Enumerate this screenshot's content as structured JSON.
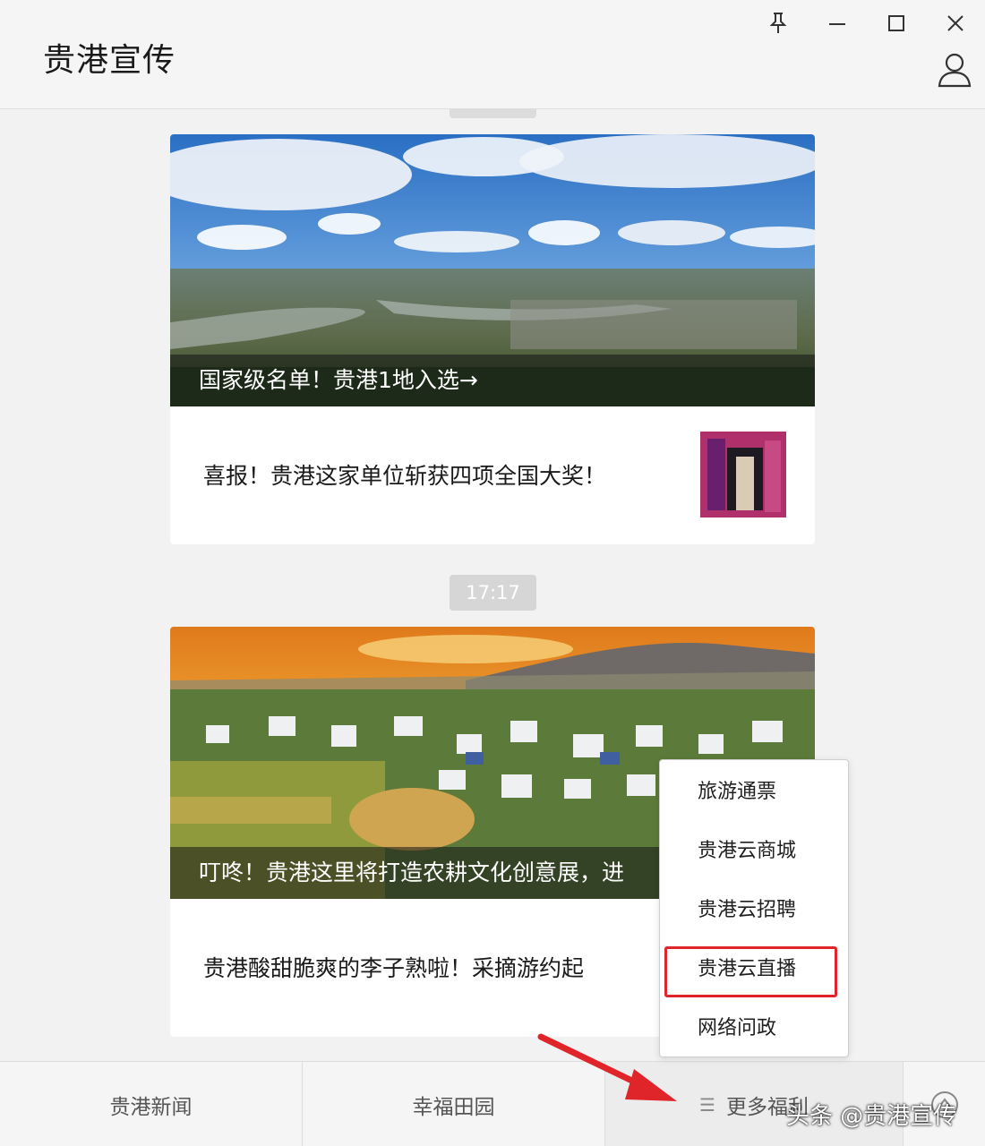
{
  "window": {
    "title": "贵港宣传",
    "controls": [
      "pin-icon",
      "minimize-icon",
      "maximize-icon",
      "close-icon"
    ],
    "profile_icon": "user-icon"
  },
  "feed": {
    "timestamp": "17:17",
    "cards": [
      {
        "hero_caption": "国家级名单！贵港1地入选→",
        "sub_item_title": "喜报！贵港这家单位斩获四项全国大奖！"
      },
      {
        "hero_caption": "叮咚！贵港这里将打造农耕文化创意展，进",
        "sub_item_title": "贵港酸甜脆爽的李子熟啦！采摘游约起"
      }
    ]
  },
  "menubar": {
    "items": [
      "贵港新闻",
      "幸福田园",
      "更多福利"
    ],
    "more_icon": "menu-lines-icon",
    "keyboard_icon": "keyboard-toggle-icon"
  },
  "popup": {
    "items": [
      "旅游通票",
      "贵港云商城",
      "贵港云招聘",
      "贵港云直播",
      "网络问政"
    ],
    "highlighted": "贵港云直播",
    "highlight_color": "#e0252a"
  },
  "watermark": "头条 @贵港宣传",
  "colors": {
    "background": "#f2f2f3",
    "card": "#ffffff",
    "arrow": "#e0252a"
  }
}
